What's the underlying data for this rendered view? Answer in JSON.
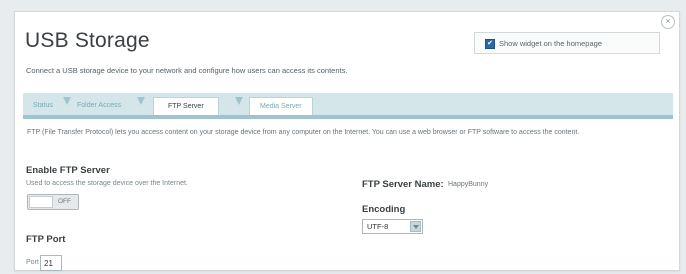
{
  "page": {
    "title": "USB Storage",
    "subtitle": "Connect a USB storage device to your network and configure how users can access its contents.",
    "close_icon": "close-icon"
  },
  "widget": {
    "label": "Show widget on the homepage",
    "checked": true
  },
  "tabs": [
    {
      "label": "Status",
      "active": false
    },
    {
      "label": "Folder Access",
      "active": false
    },
    {
      "label": "FTP Server",
      "active": true
    },
    {
      "label": "Media Server",
      "active": false
    }
  ],
  "description": "FTP (File Transfer Protocol) lets you access content on your storage device from any computer on the Internet. You can use a web browser or FTP software to access the content.",
  "enable_ftp": {
    "heading": "Enable FTP Server",
    "help": "Used to access the storage device over the Internet.",
    "toggle_state": "OFF"
  },
  "ftp_port": {
    "heading": "FTP Port",
    "label": "Port",
    "value": "21"
  },
  "server_name": {
    "heading": "FTP Server Name:",
    "value": "HappyBunny"
  },
  "encoding": {
    "heading": "Encoding",
    "selected": "UTF-8"
  },
  "colors": {
    "accent": "#2d67a6",
    "tab_bar": "#d5e6ea",
    "tab_border": "#9ec5cf"
  }
}
